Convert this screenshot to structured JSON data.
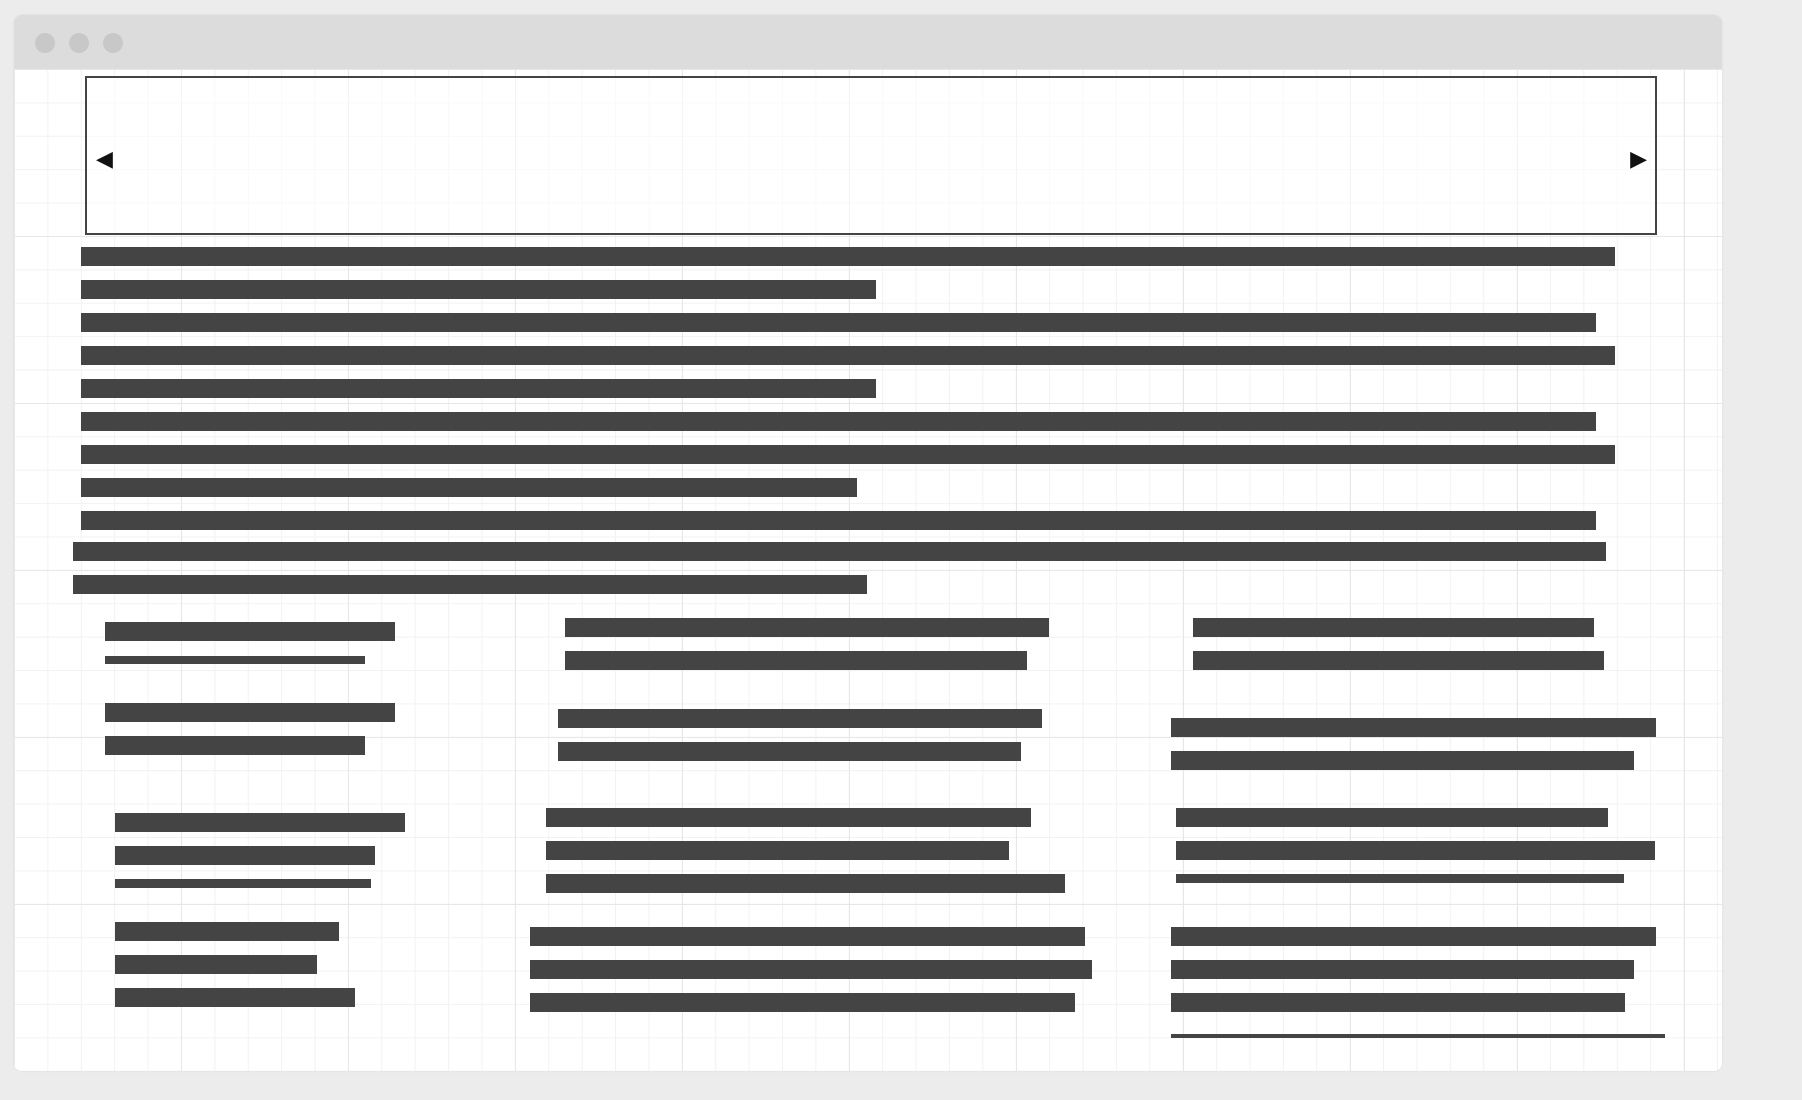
{
  "window": {
    "controls": [
      "close-dot",
      "minimize-dot",
      "maximize-dot"
    ],
    "chrome_color": "#dcdcdc"
  },
  "carousel": {
    "prev_icon": "◀",
    "next_icon": "▶"
  },
  "colors": {
    "text_placeholder": "#444444",
    "grid_major": "#e7e7e7",
    "grid_minor": "#f2f2f2",
    "background": "#ececec"
  }
}
